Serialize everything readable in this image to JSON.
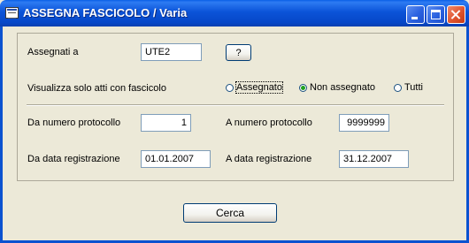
{
  "window": {
    "title": "ASSEGNA FASCICOLO / Varia",
    "icons": {
      "app": "app-window-icon",
      "minimize": "minimize-icon",
      "maximize": "maximize-icon",
      "close": "close-icon"
    }
  },
  "form": {
    "assegnati_label": "Assegnati a",
    "assegnati_value": "UTE2",
    "lookup_button": "?",
    "filter_label": "Visualizza solo atti con fascicolo",
    "radio_options": [
      {
        "label": "Assegnato",
        "selected": false
      },
      {
        "label": "Non assegnato",
        "selected": true
      },
      {
        "label": "Tutti",
        "selected": false
      }
    ],
    "da_protocollo_label": "Da numero protocollo",
    "da_protocollo_value": "1",
    "a_protocollo_label": "A  numero protocollo",
    "a_protocollo_value": "9999999",
    "da_data_label": "Da data registrazione",
    "da_data_value": "01.01.2007",
    "a_data_label": "A  data registrazione",
    "a_data_value": "31.12.2007"
  },
  "actions": {
    "search_label": "Cerca"
  },
  "colors": {
    "titlebar": "#0b53d8",
    "window_bg": "#ece9d8",
    "field_border": "#7f9db9",
    "radio_selected": "#21a121"
  }
}
